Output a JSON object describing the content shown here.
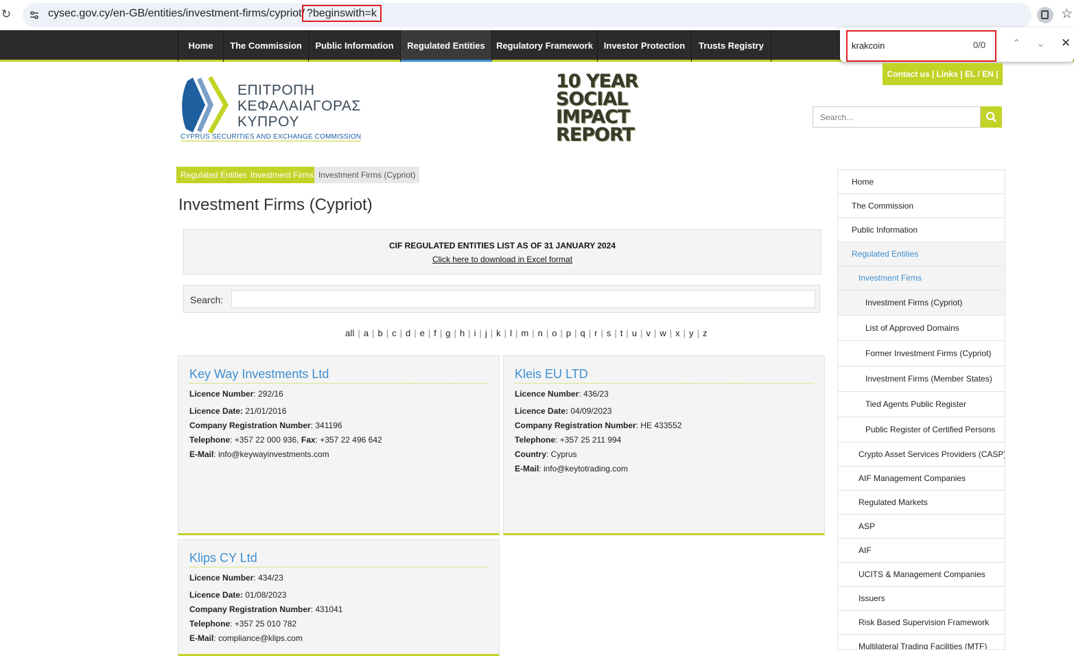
{
  "browser": {
    "url_base": "cysec.gov.cy/en-GB/entities/investment-firms/cypriot/",
    "url_query": "?beginswith=k"
  },
  "find": {
    "query": "krakcoin",
    "count": "0/0"
  },
  "nav": [
    "Home",
    "The Commission",
    "Public Information",
    "Regulated Entities",
    "Regulatory Framework",
    "Investor Protection",
    "Trusts Registry"
  ],
  "contact": "Contact us | Links | EL / EN |",
  "logo": {
    "line1": "ΕΠΙΤΡΟΠΗ",
    "line2": "ΚΕΦΑΛΑΙΑΓΟΡΑΣ",
    "line3": "ΚΥΠΡΟΥ",
    "english": "CYPRUS SECURITIES AND EXCHANGE COMMISSION"
  },
  "report": [
    "10 YEAR",
    "SOCIAL",
    "IMPACT",
    "REPORT"
  ],
  "site_search": {
    "placeholder": "Search..."
  },
  "breadcrumb": [
    "Regulated Entities",
    "Investment Firms",
    "Investment Firms (Cypriot)"
  ],
  "title": "Investment Firms (Cypriot)",
  "notice": {
    "title": "CIF REGULATED ENTITIES LIST AS OF 31 JANUARY 2024",
    "link": "Click here to download in Excel format"
  },
  "search_label": "Search:",
  "alphabet": [
    "all",
    "a",
    "b",
    "c",
    "d",
    "e",
    "f",
    "g",
    "h",
    "i",
    "j",
    "k",
    "l",
    "m",
    "n",
    "o",
    "p",
    "q",
    "r",
    "s",
    "t",
    "u",
    "v",
    "w",
    "x",
    "y",
    "z"
  ],
  "cards": [
    {
      "name": "Key Way Investments Ltd",
      "licence_number": "292/16",
      "licence_date": "21/01/2016",
      "company_reg": "341196",
      "telephone": "+357 22 000 936",
      "fax": "+357 22 496 642",
      "email": "info@keywayinvestments.com"
    },
    {
      "name": "Kleis EU LTD",
      "licence_number": "436/23",
      "licence_date": "04/09/2023",
      "company_reg": "HE 433552",
      "telephone": "+357 25 211 994",
      "country": "Cyprus",
      "email": "info@keytotrading.com"
    },
    {
      "name": "Klips CY Ltd",
      "licence_number": "434/23",
      "licence_date": "01/08/2023",
      "company_reg": "431041",
      "telephone": "+357 25 010 782",
      "email": "compliance@klips.com"
    }
  ],
  "labels": {
    "licence_number": "Licence Number",
    "licence_date": "Licence Date:",
    "company_reg": "Company Registration Number",
    "telephone": "Telephone",
    "fax": "Fax",
    "country": "Country",
    "email": "E-Mail"
  },
  "sidebar": [
    "Home",
    "The Commission",
    "Public Information",
    "Regulated Entities",
    "Investment Firms",
    "Investment Firms (Cypriot)",
    "List of Approved Domains",
    "Former Investment Firms (Cypriot)",
    "Investment Firms (Member States)",
    "Tied Agents Public Register",
    "Public Register of Certified Persons",
    "Crypto Asset Services Providers (CASP)",
    "AIF Management Companies",
    "Regulated Markets",
    "ASP",
    "AIF",
    "UCITS & Management Companies",
    "Issuers",
    "Risk Based Supervision Framework",
    "Multilateral Trading Facilities (MTF)"
  ],
  "colors": {
    "accent_green": "#c2d327",
    "link_blue": "#3d8fd1",
    "nav_dark": "#2b2b2b"
  }
}
